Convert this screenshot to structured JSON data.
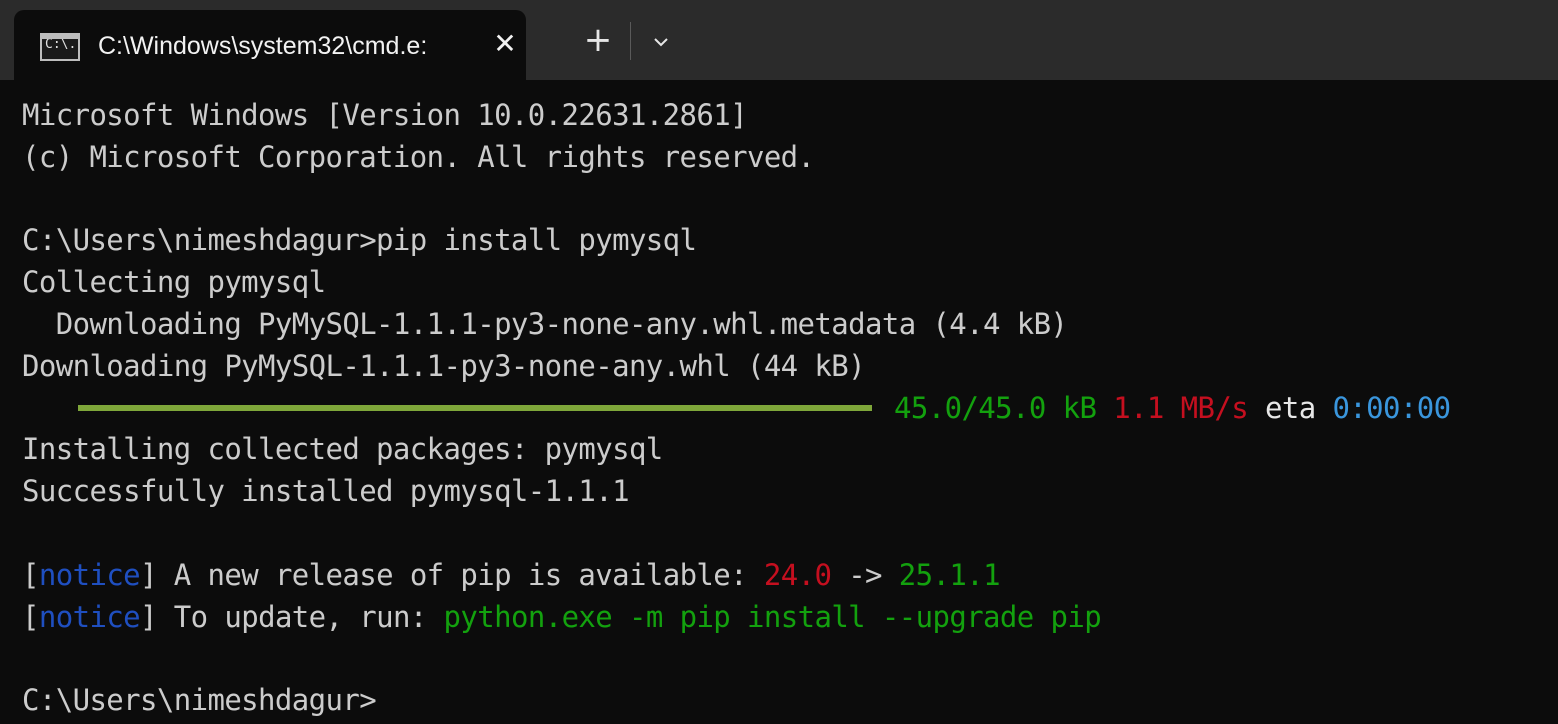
{
  "tab": {
    "icon_text": "C:\\.",
    "title": "C:\\Windows\\system32\\cmd.e:",
    "close_label": "✕",
    "new_tab_label": "+"
  },
  "terminal": {
    "line1": "Microsoft Windows [Version 10.0.22631.2861]",
    "line2": "(c) Microsoft Corporation. All rights reserved.",
    "line3": "C:\\Users\\nimeshdagur>pip install pymysql",
    "line4": "Collecting pymysql",
    "line5": "  Downloading PyMySQL-1.1.1-py3-none-any.whl.metadata (4.4 kB)",
    "line6": "Downloading PyMySQL-1.1.1-py3-none-any.whl (44 kB)",
    "progress": {
      "fraction": 1.0,
      "size": "45.0/45.0 kB",
      "speed": "1.1 MB/s",
      "eta_label": "eta",
      "eta_value": "0:00:00"
    },
    "line8": "Installing collected packages: pymysql",
    "line9": "Successfully installed pymysql-1.1.1",
    "notice1": {
      "open": "[",
      "tag": "notice",
      "close": "]",
      "text": " A new release of pip is available: ",
      "old_version": "24.0",
      "arrow": " -> ",
      "new_version": "25.1.1"
    },
    "notice2": {
      "open": "[",
      "tag": "notice",
      "close": "]",
      "text": " To update, run: ",
      "command": "python.exe -m pip install --upgrade pip"
    },
    "prompt": "C:\\Users\\nimeshdagur>"
  },
  "colors": {
    "background": "#0c0c0c",
    "text": "#cccccc",
    "green": "#13a10e",
    "red": "#c50f1f",
    "blue": "#3a96dd",
    "notice_blue": "#1f4fc0",
    "progress_bar": "#7fa73a"
  }
}
